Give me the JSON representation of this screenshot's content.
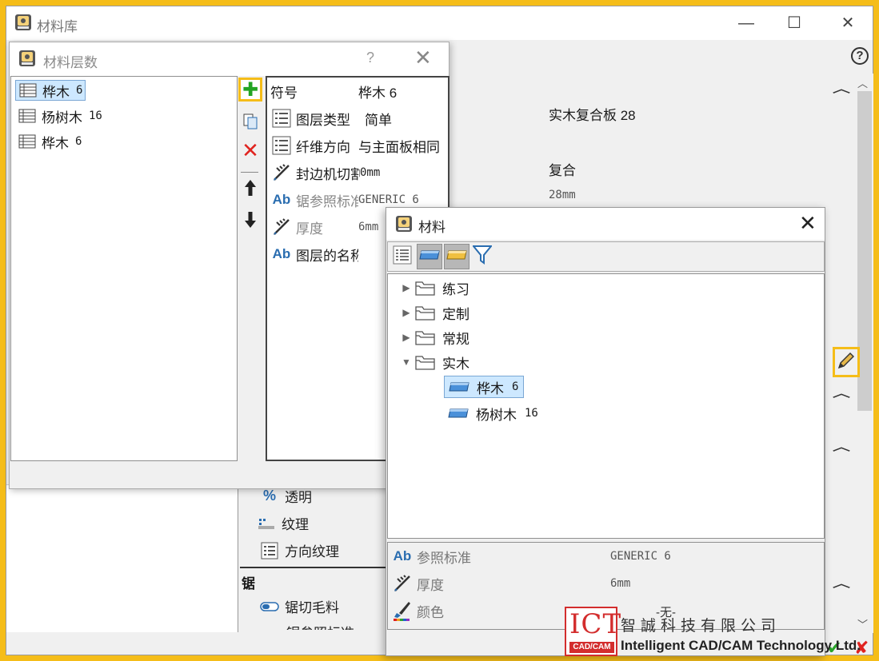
{
  "main_window": {
    "title": "材料库",
    "buttons": {
      "minimize": "—",
      "maximize": "☐",
      "close": "✕"
    },
    "help": "?"
  },
  "background": {
    "name_value": "实木复合板 28",
    "type_value": "复合",
    "thickness_value": "28mm",
    "rows": [
      {
        "icon": "percent-icon",
        "label": "透明"
      },
      {
        "icon": "texture-icon",
        "label": "纹理"
      },
      {
        "icon": "list-icon",
        "label": "方向纹理"
      }
    ],
    "saw_section": "锯",
    "saw_row": {
      "icon": "saw-blank-icon",
      "label": "锯切毛料"
    },
    "cut_row_partial": "锯参照标准"
  },
  "layers_dialog": {
    "title": "材料层数",
    "help": "?",
    "close": "✕",
    "layers": [
      {
        "name": "桦木",
        "value": "6",
        "selected": true
      },
      {
        "name": "杨树木",
        "value": "16",
        "selected": false
      },
      {
        "name": "桦木",
        "value": "6",
        "selected": false
      }
    ],
    "tools": {
      "add": "✚",
      "delete": "✕",
      "up": "🡅",
      "down": "🡇"
    },
    "properties": {
      "symbol": {
        "label": "符号",
        "value": "桦木 6"
      },
      "layer_type": {
        "label": "图层类型",
        "value": "简单"
      },
      "fiber_dir": {
        "label": "纤维方向",
        "value": "与主面板相同"
      },
      "edge_cut": {
        "label": "封边机切割",
        "value": "0mm"
      },
      "saw_ref": {
        "label": "锯参照标准",
        "value": "GENERIC 6"
      },
      "thickness": {
        "label": "厚度",
        "value": "6mm"
      },
      "layer_name": {
        "label": "图层的名称",
        "value": ""
      }
    }
  },
  "material_dialog": {
    "title": "材料",
    "close": "✕",
    "tree": [
      {
        "label": "练习",
        "expanded": false
      },
      {
        "label": "定制",
        "expanded": false
      },
      {
        "label": "常规",
        "expanded": false
      },
      {
        "label": "实木",
        "expanded": true
      }
    ],
    "leaves": [
      {
        "name": "桦木",
        "value": "6",
        "selected": true
      },
      {
        "name": "杨树木",
        "value": "16",
        "selected": false
      }
    ],
    "props": {
      "ref": {
        "label": "参照标准",
        "value": "GENERIC 6"
      },
      "thickness": {
        "label": "厚度",
        "value": "6mm"
      },
      "color": {
        "label": "颜色",
        "value": "-无-"
      }
    }
  },
  "watermark": {
    "logo": "ICT",
    "logo_sub": "CAD/CAM",
    "cn": "智誠科技有限公司",
    "en": "Intelligent CAD/CAM Technology Ltd."
  },
  "colors": {
    "highlight": "#f5bd19",
    "selection": "#cde8ff",
    "add_green": "#23a423",
    "delete_red": "#e0231f",
    "ab_blue": "#2a6db0"
  }
}
